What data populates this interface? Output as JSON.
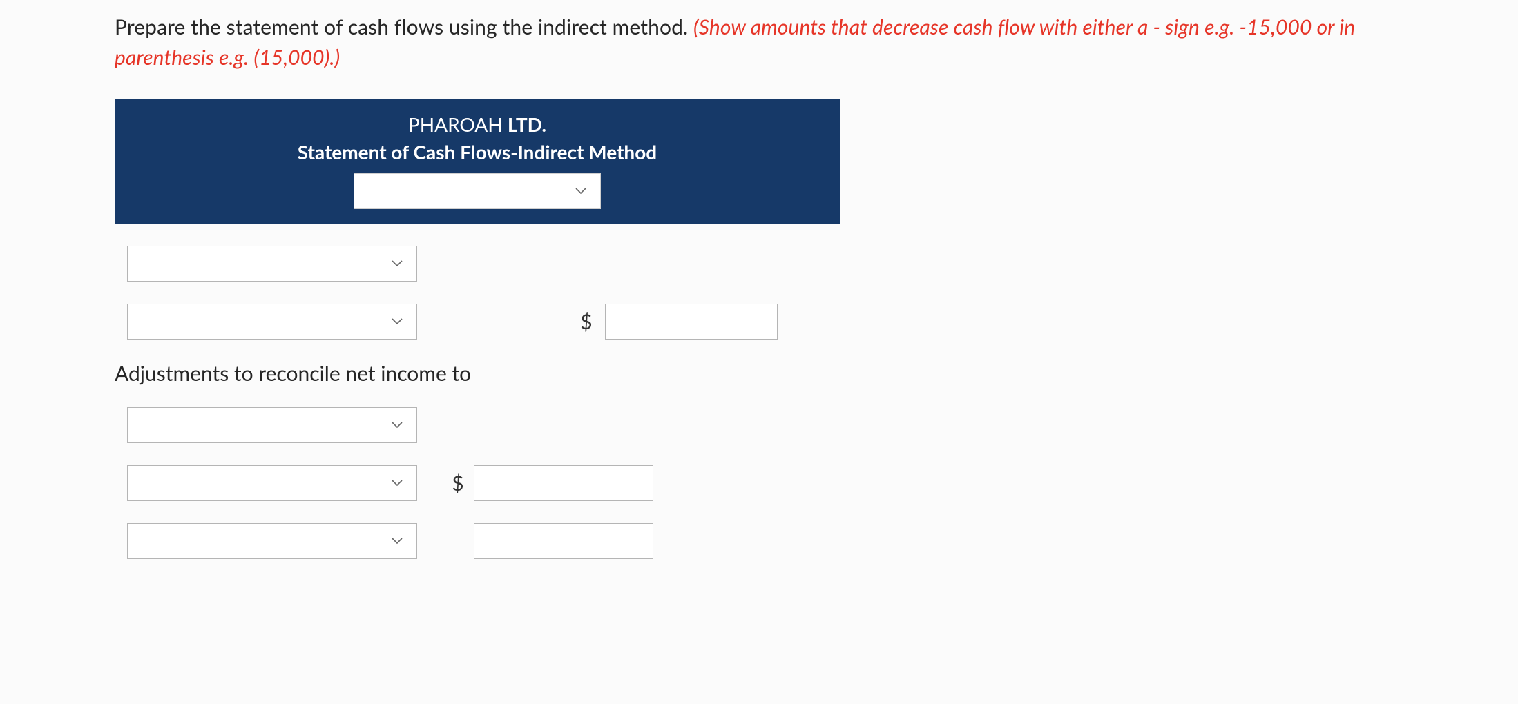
{
  "prompt": {
    "lead": "Prepare the statement of cash flows using the indirect method. ",
    "highlight": "(Show amounts that decrease cash flow with either a - sign e.g. -15,000 or in parenthesis e.g. (15,000).)"
  },
  "header": {
    "company_pre": "PHAROAH ",
    "company_bold": "LTD.",
    "title": "Statement of Cash Flows-Indirect Method",
    "period_value": ""
  },
  "adjustments_label": "Adjustments to reconcile net income to",
  "dollar_sign": "$",
  "rows": {
    "r1": {
      "sel": ""
    },
    "r2": {
      "sel": "",
      "amt": ""
    },
    "r3": {
      "sel": ""
    },
    "r4": {
      "sel": "",
      "amt": ""
    },
    "r5": {
      "sel": "",
      "amt": ""
    }
  }
}
